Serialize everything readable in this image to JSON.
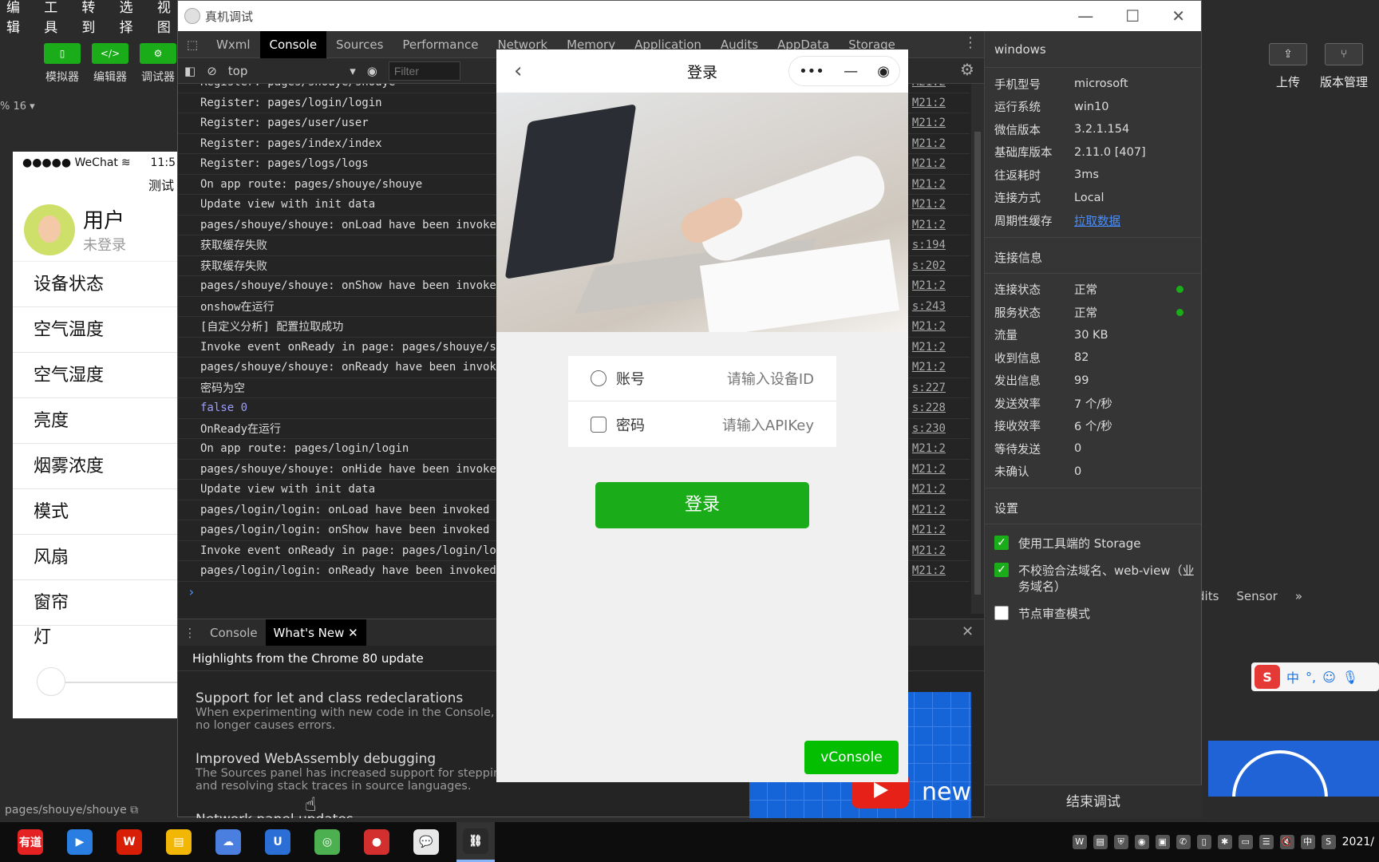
{
  "ide": {
    "menu": [
      "编辑",
      "工具",
      "转到",
      "选择",
      "视图"
    ],
    "toolbar": [
      {
        "icon": "phone-icon",
        "glyph": "▯",
        "label": "模拟器"
      },
      {
        "icon": "code-icon",
        "glyph": "</>",
        "label": "编辑器"
      },
      {
        "icon": "debug-icon",
        "glyph": "⚙",
        "label": "调试器"
      }
    ],
    "zoom": "% 16 ▾",
    "right_tools": [
      {
        "icon": "upload-icon",
        "glyph": "⇪",
        "label": "上传"
      },
      {
        "icon": "branch-icon",
        "glyph": "⑂",
        "label": "版本管理"
      }
    ],
    "path": "pages/shouye/shouye",
    "right_tabs": [
      "dits",
      "Sensor",
      "»"
    ]
  },
  "simulator": {
    "carrier": "●●●●● WeChat",
    "time": "11:5",
    "nav_title": "测试",
    "user_name": "用户",
    "user_status": "未登录",
    "rows": [
      "设备状态",
      "空气温度",
      "空气湿度",
      "亮度",
      "烟雾浓度",
      "模式",
      "风扇",
      "窗帘",
      "灯"
    ]
  },
  "window": {
    "title": "真机调试",
    "controls": [
      "—",
      "☐",
      "✕"
    ]
  },
  "devtools": {
    "tabs": [
      "Wxml",
      "Console",
      "Sources",
      "Performance",
      "Network",
      "Memory",
      "Application",
      "Audits",
      "AppData",
      "Storage"
    ],
    "active_tab": "Console",
    "context": "top",
    "filter_placeholder": "Filter",
    "console_lines": [
      {
        "text": "Register: pages/shouye/shouye",
        "src": "M21:2"
      },
      {
        "text": "Register: pages/login/login",
        "src": "M21:2"
      },
      {
        "text": "Register: pages/user/user",
        "src": "M21:2"
      },
      {
        "text": "Register: pages/index/index",
        "src": "M21:2"
      },
      {
        "text": "Register: pages/logs/logs",
        "src": "M21:2"
      },
      {
        "text": "On app route: pages/shouye/shouye",
        "src": "M21:2"
      },
      {
        "text": "Update view with init data",
        "src": "M21:2"
      },
      {
        "text": "pages/shouye/shouye: onLoad have been invoked",
        "src": "M21:2"
      },
      {
        "text": "获取缓存失败",
        "src": "s:194"
      },
      {
        "text": "获取缓存失败",
        "src": "s:202"
      },
      {
        "text": "pages/shouye/shouye: onShow have been invoked",
        "src": "M21:2"
      },
      {
        "text": "onshow在运行",
        "src": "s:243"
      },
      {
        "text": "[自定义分析] 配置拉取成功",
        "src": "M21:2"
      },
      {
        "text": "Invoke event onReady in page: pages/shouye/sh",
        "src": "M21:2"
      },
      {
        "text": "pages/shouye/shouye: onReady have been invoke",
        "src": "M21:2"
      },
      {
        "text": "密码为空",
        "src": "s:227"
      },
      {
        "text": "false 0",
        "src": "s:228",
        "num": true
      },
      {
        "text": "OnReady在运行",
        "src": "s:230"
      },
      {
        "text": "On app route: pages/login/login",
        "src": "M21:2"
      },
      {
        "text": "pages/shouye/shouye: onHide have been invoked",
        "src": "M21:2"
      },
      {
        "text": "Update view with init data",
        "src": "M21:2"
      },
      {
        "text": "pages/login/login: onLoad have been invoked",
        "src": "M21:2"
      },
      {
        "text": "pages/login/login: onShow have been invoked",
        "src": "M21:2"
      },
      {
        "text": "Invoke event onReady in page: pages/login/log",
        "src": "M21:2"
      },
      {
        "text": "pages/login/login: onReady have been invoked",
        "src": "M21:2"
      }
    ],
    "prompt": "›",
    "drawer_tabs": [
      "Console",
      "What's New"
    ],
    "drawer_active": "What's New",
    "whats_new_title": "Highlights from the Chrome 80 update",
    "whats_new_items": [
      {
        "title": "Support for let and class redeclarations",
        "desc": "When experimenting with new code in the Console, r\nno longer causes errors."
      },
      {
        "title": "Improved WebAssembly debugging",
        "desc": "The Sources panel has increased support for stepping\nand resolving stack traces in source languages."
      },
      {
        "title": "Network panel updates",
        "desc": ""
      }
    ],
    "video_text": "new"
  },
  "info": {
    "device_label": "windows",
    "device": [
      {
        "k": "手机型号",
        "v": "microsoft"
      },
      {
        "k": "运行系统",
        "v": "win10"
      },
      {
        "k": "微信版本",
        "v": "3.2.1.154"
      },
      {
        "k": "基础库版本",
        "v": "2.11.0 [407]"
      },
      {
        "k": "往返耗时",
        "v": "3ms"
      },
      {
        "k": "连接方式",
        "v": "Local"
      },
      {
        "k": "周期性缓存",
        "v": "拉取数据",
        "link": true
      }
    ],
    "conn_title": "连接信息",
    "conn": [
      {
        "k": "连接状态",
        "v": "正常",
        "dot": true
      },
      {
        "k": "服务状态",
        "v": "正常",
        "dot": true
      },
      {
        "k": "流量",
        "v": "30 KB"
      },
      {
        "k": "收到信息",
        "v": "82"
      },
      {
        "k": "发出信息",
        "v": "99"
      },
      {
        "k": "发送效率",
        "v": "7 个/秒"
      },
      {
        "k": "接收效率",
        "v": "6 个/秒"
      },
      {
        "k": "等待发送",
        "v": "0"
      },
      {
        "k": "未确认",
        "v": "0"
      }
    ],
    "settings_title": "设置",
    "settings": [
      {
        "label": "使用工具端的 Storage",
        "checked": true
      },
      {
        "label": "不校验合法域名、web-view（业务域名）",
        "checked": true
      },
      {
        "label": "节点审查模式",
        "checked": false
      }
    ],
    "end_button": "结束调试"
  },
  "phone": {
    "title": "登录",
    "back": "‹",
    "capsule": [
      "•••",
      "—",
      "◉"
    ],
    "account_label": "账号",
    "account_placeholder": "请输入设备ID",
    "password_label": "密码",
    "password_placeholder": "请输入APIKey",
    "login_button": "登录",
    "vconsole": "vConsole"
  },
  "ime": {
    "logo": "S",
    "lang": "中",
    "punct": "°,"
  },
  "taskbar": {
    "apps": [
      {
        "name": "youdao-icon",
        "color": "#e52222",
        "glyph": "有道"
      },
      {
        "name": "play-icon",
        "color": "#2a7de1",
        "glyph": "▶"
      },
      {
        "name": "wps-icon",
        "color": "#d81e06",
        "glyph": "W"
      },
      {
        "name": "folder-icon",
        "color": "#f2b705",
        "glyph": "▤"
      },
      {
        "name": "cloud-icon",
        "color": "#4a7fe0",
        "glyph": "☁"
      },
      {
        "name": "shield-icon",
        "color": "#2b6fd6",
        "glyph": "U"
      },
      {
        "name": "chrome-icon",
        "color": "#4caf50",
        "glyph": "◎"
      },
      {
        "name": "record-icon",
        "color": "#d32f2f",
        "glyph": "●"
      },
      {
        "name": "wechat-icon",
        "color": "#e8e8e8",
        "glyph": "💬"
      },
      {
        "name": "devtool-icon",
        "color": "#2a2a2a",
        "glyph": "⛓",
        "active": true
      }
    ],
    "tray": [
      "W",
      "▤",
      "⛨",
      "◉",
      "▣",
      "✆",
      "▯",
      "✱",
      "▭",
      "☰",
      "🔇",
      "中",
      "S"
    ],
    "time": "2021/"
  }
}
